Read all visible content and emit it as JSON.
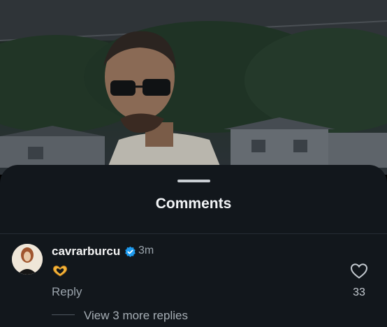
{
  "sheet": {
    "title": "Comments"
  },
  "comment": {
    "username": "cavrarburcu",
    "time": "3m",
    "reply_label": "Reply",
    "likes": "33",
    "view_replies": "View 3 more replies"
  },
  "icons": [
    "verified-badge-icon",
    "heart-hands-emoji-icon",
    "like-heart-icon"
  ],
  "colors": {
    "sheet_bg": "#12171c",
    "verified_blue": "#1d9bf0",
    "secondary_text": "#9aa3ab"
  }
}
